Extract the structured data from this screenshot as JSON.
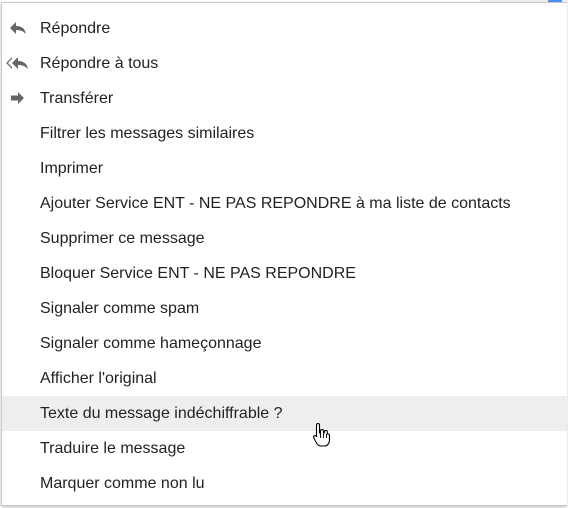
{
  "menu": {
    "items": [
      {
        "label": "Répondre",
        "icon": "reply-icon"
      },
      {
        "label": "Répondre à tous",
        "icon": "reply-all-icon"
      },
      {
        "label": "Transférer",
        "icon": "forward-icon"
      },
      {
        "label": "Filtrer les messages similaires"
      },
      {
        "label": "Imprimer"
      },
      {
        "label": "Ajouter Service ENT - NE PAS REPONDRE à ma liste de contacts"
      },
      {
        "label": "Supprimer ce message"
      },
      {
        "label": "Bloquer Service ENT - NE PAS REPONDRE"
      },
      {
        "label": "Signaler comme spam"
      },
      {
        "label": "Signaler comme hameçonnage"
      },
      {
        "label": "Afficher l'original"
      },
      {
        "label": "Texte du message indéchiffrable ?",
        "hovered": true
      },
      {
        "label": "Traduire le message"
      },
      {
        "label": "Marquer comme non lu"
      }
    ]
  },
  "colors": {
    "text": "#222222",
    "hover_bg": "#eeeeee",
    "icon": "#666666"
  },
  "cursor": {
    "icon": "hand-pointer-icon"
  }
}
